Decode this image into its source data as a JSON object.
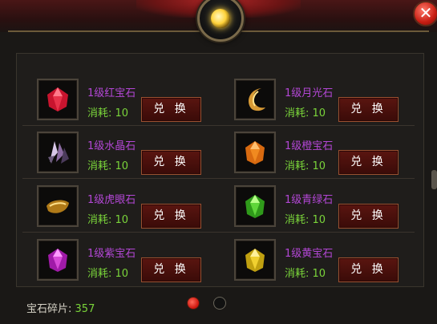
{
  "items": [
    {
      "name": "1级红宝石",
      "cost": "消耗: 10",
      "button": "兑 换",
      "gem": "red-gem-icon",
      "color": "#e8324a"
    },
    {
      "name": "1级月光石",
      "cost": "消耗: 10",
      "button": "兑 换",
      "gem": "moonstone-icon",
      "color": "#d89a35"
    },
    {
      "name": "1级水晶石",
      "cost": "消耗: 10",
      "button": "兑 换",
      "gem": "crystal-icon",
      "color": "#a688b6"
    },
    {
      "name": "1级橙宝石",
      "cost": "消耗: 10",
      "button": "兑 换",
      "gem": "orange-gem-icon",
      "color": "#f08a20"
    },
    {
      "name": "1级虎眼石",
      "cost": "消耗: 10",
      "button": "兑 换",
      "gem": "tigers-eye-icon",
      "color": "#d8a12a"
    },
    {
      "name": "1级青绿石",
      "cost": "消耗: 10",
      "button": "兑 换",
      "gem": "green-gem-icon",
      "color": "#5fd63a"
    },
    {
      "name": "1级紫宝石",
      "cost": "消耗: 10",
      "button": "兑 换",
      "gem": "purple-gem-icon",
      "color": "#d84ad8"
    },
    {
      "name": "1级黄宝石",
      "cost": "消耗: 10",
      "button": "兑 换",
      "gem": "yellow-gem-icon",
      "color": "#f0d030"
    }
  ],
  "footer": {
    "label": "宝石碎片:",
    "value": "357"
  },
  "close_glyph": "✕",
  "pagination": {
    "current": 1,
    "total": 2
  }
}
